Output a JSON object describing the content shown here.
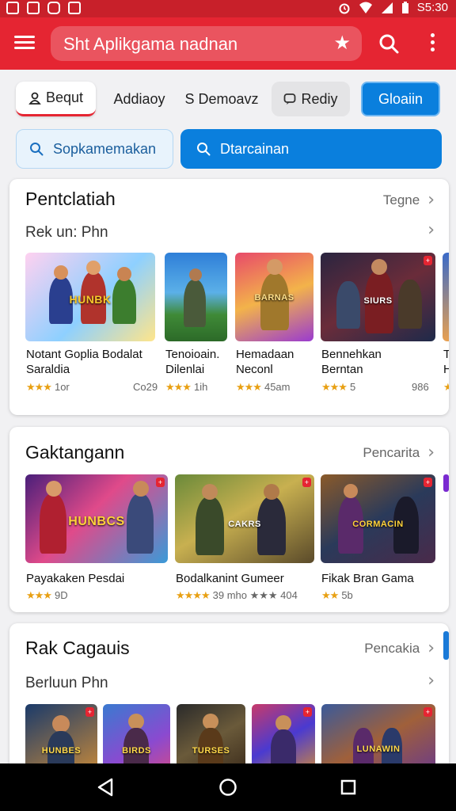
{
  "status_bar": {
    "time": "S5:30"
  },
  "app_bar": {
    "search_text": "Sht Aplikgama nadnan"
  },
  "chips": [
    {
      "label": "Bequt"
    },
    {
      "label": "Addiaoy"
    },
    {
      "label": "S Demoavz"
    },
    {
      "label": "Rediy"
    },
    {
      "label": "Gloaiin"
    }
  ],
  "search_buttons": [
    {
      "label": "Sopkamemakan"
    },
    {
      "label": "Dtarcainan"
    }
  ],
  "sections": [
    {
      "title": "Pentclatiah",
      "more": "Tegne",
      "subheading": "Rek un: Phn",
      "games": [
        {
          "name": "Notant Goplia Bodalat",
          "name2": "Saraldia",
          "rating": "★★★",
          "meta": "1or",
          "extra": "Co29",
          "art": "HUNBK"
        },
        {
          "name": "Tenoioain.",
          "name2": "Dilenlai",
          "rating": "★★★",
          "meta": "1ih",
          "extra": "",
          "art": ""
        },
        {
          "name": "Hemadaan",
          "name2": "Neconl",
          "rating": "★★★",
          "meta": "45am",
          "extra": "",
          "art": "BARNAS"
        },
        {
          "name": "Bennehkan",
          "name2": "Berntan",
          "rating": "★★★",
          "meta": "5",
          "extra": "986",
          "art": "SIURS"
        },
        {
          "name": "Th",
          "name2": "H",
          "rating": "★",
          "meta": "",
          "extra": "",
          "art": ""
        }
      ]
    },
    {
      "title": "Gaktangann",
      "more": "Pencarita",
      "subheading": "",
      "games": [
        {
          "name": "Payakaken Pesdai",
          "name2": "",
          "rating": "★★★",
          "meta": "9D",
          "extra": "",
          "art": "HUNBCS"
        },
        {
          "name": "Bodalkanint Gumeer",
          "name2": "",
          "rating": "★★★★",
          "meta": "39 mho ★★★ 404",
          "extra": "",
          "art": "CAKRS"
        },
        {
          "name": "Fikak Bran Gama",
          "name2": "",
          "rating": "★★",
          "meta": "5b",
          "extra": "",
          "art": "CORMACIN"
        }
      ]
    },
    {
      "title": "Rak Cagauis",
      "more": "Pencakia",
      "subheading": "Berluun Phn",
      "games": [
        {
          "name": "",
          "name2": "",
          "rating": "",
          "meta": "",
          "extra": "",
          "art": "HUNBES"
        },
        {
          "name": "",
          "name2": "",
          "rating": "",
          "meta": "",
          "extra": "",
          "art": "BIRDS"
        },
        {
          "name": "",
          "name2": "",
          "rating": "",
          "meta": "",
          "extra": "",
          "art": "TURSES"
        },
        {
          "name": "",
          "name2": "",
          "rating": "",
          "meta": "",
          "extra": "",
          "art": ""
        },
        {
          "name": "",
          "name2": "",
          "rating": "",
          "meta": "",
          "extra": "",
          "art": "LUNAWIN"
        }
      ]
    }
  ],
  "colors": {
    "brand_red": "#e52532",
    "accent_blue": "#0a7fdd",
    "star": "#e8a013"
  }
}
